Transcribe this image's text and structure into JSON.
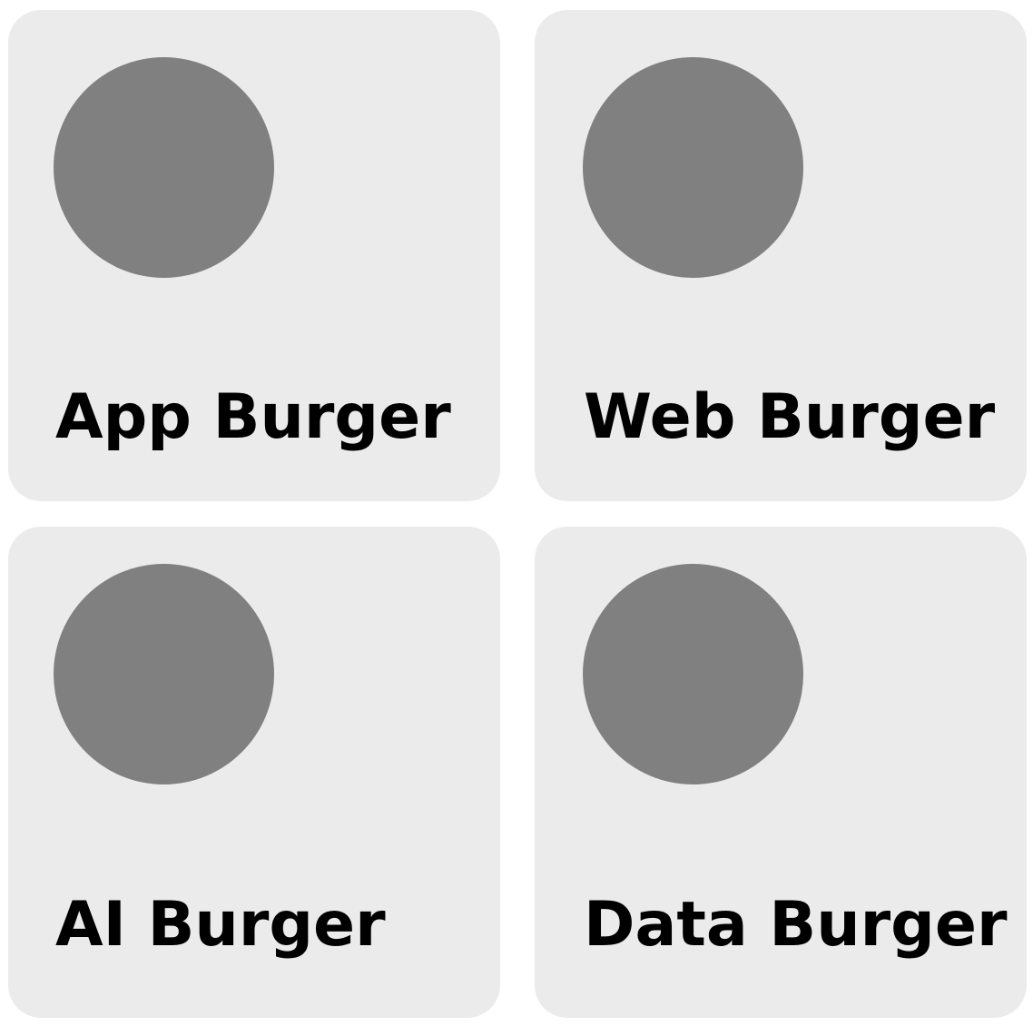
{
  "colors": {
    "card_background": "#ebebeb",
    "thumbnail": "#808080",
    "label_text": "#000000",
    "page_background": "#ffffff"
  },
  "cards": [
    {
      "label": "App Burger",
      "icon": "thumbnail-circle"
    },
    {
      "label": "Web Burger",
      "icon": "thumbnail-circle"
    },
    {
      "label": "AI Burger",
      "icon": "thumbnail-circle"
    },
    {
      "label": "Data Burger",
      "icon": "thumbnail-circle"
    }
  ]
}
